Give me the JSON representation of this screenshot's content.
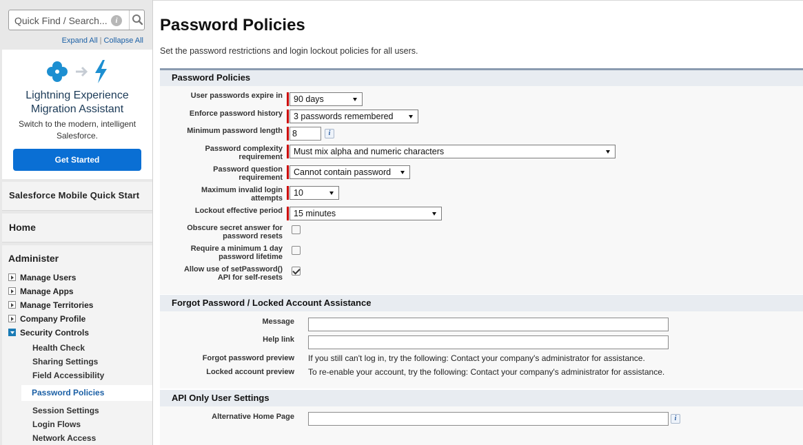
{
  "sidebar": {
    "search_placeholder": "Quick Find / Search...",
    "expand_all": "Expand All",
    "separator": "|",
    "collapse_all": "Collapse All",
    "migration": {
      "title_line1": "Lightning Experience",
      "title_line2": "Migration Assistant",
      "subtitle": "Switch to the modern, intelligent Salesforce.",
      "button": "Get Started"
    },
    "mobile_quick_start": "Salesforce Mobile Quick Start",
    "home": "Home",
    "administer": "Administer",
    "tree": [
      {
        "label": "Manage Users",
        "open": false
      },
      {
        "label": "Manage Apps",
        "open": false
      },
      {
        "label": "Manage Territories",
        "open": false
      },
      {
        "label": "Company Profile",
        "open": false
      },
      {
        "label": "Security Controls",
        "open": true
      }
    ],
    "security_items": [
      "Health Check",
      "Sharing Settings",
      "Field Accessibility",
      "Password Policies",
      "Session Settings",
      "Login Flows",
      "Network Access"
    ],
    "active_item": "Password Policies"
  },
  "main": {
    "title": "Password Policies",
    "description": "Set the password restrictions and login lockout policies for all users.",
    "password_policies": {
      "heading": "Password Policies",
      "fields": {
        "expire_label": "User passwords expire in",
        "expire_value": "90 days",
        "history_label": "Enforce password history",
        "history_value": "3 passwords remembered",
        "min_length_label": "Minimum password length",
        "min_length_value": "8",
        "complexity_label_1": "Password complexity",
        "complexity_label_2": "requirement",
        "complexity_value": "Must mix alpha and numeric characters",
        "question_label_1": "Password question",
        "question_label_2": "requirement",
        "question_value": "Cannot contain password",
        "max_invalid_label_1": "Maximum invalid login",
        "max_invalid_label_2": "attempts",
        "max_invalid_value": "10",
        "lockout_label": "Lockout effective period",
        "lockout_value": "15 minutes",
        "obscure_label_1": "Obscure secret answer for",
        "obscure_label_2": "password resets",
        "obscure_checked": false,
        "min_lifetime_label_1": "Require a minimum 1 day",
        "min_lifetime_label_2": "password lifetime",
        "min_lifetime_checked": false,
        "setpassword_label_1": "Allow use of setPassword()",
        "setpassword_label_2": "API for self-resets",
        "setpassword_checked": true
      }
    },
    "forgot_password": {
      "heading": "Forgot Password / Locked Account Assistance",
      "message_label": "Message",
      "message_value": "",
      "help_link_label": "Help link",
      "help_link_value": "",
      "forgot_preview_label": "Forgot password preview",
      "forgot_preview_value": "If you still can't log in, try the following: Contact your company's administrator for assistance.",
      "locked_preview_label": "Locked account preview",
      "locked_preview_value": "To re-enable your account, try the following: Contact your company's administrator for assistance."
    },
    "api_only": {
      "heading": "API Only User Settings",
      "alt_home_label": "Alternative Home Page",
      "alt_home_value": ""
    },
    "info_glyph": "i"
  },
  "colors": {
    "accent_button": "#0a6fd4",
    "required_bar": "#cc0000",
    "link": "#1a5fa5",
    "section_header": "#e8ecf1"
  }
}
